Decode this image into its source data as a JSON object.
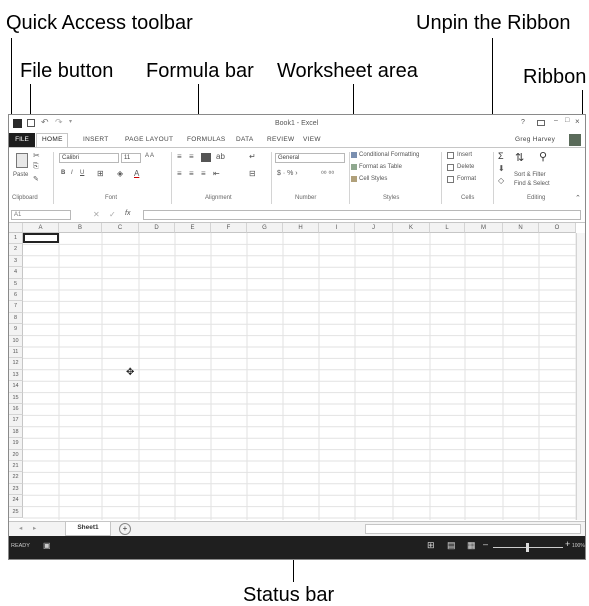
{
  "callouts": {
    "quick_access": "Quick Access toolbar",
    "file_button": "File button",
    "formula_bar": "Formula bar",
    "worksheet_area": "Worksheet area",
    "unpin_ribbon": "Unpin the Ribbon",
    "ribbon": "Ribbon",
    "status_bar": "Status bar"
  },
  "window": {
    "title": "Book1 - Excel",
    "help": "?",
    "user": "Greg Harvey",
    "controls": [
      "?",
      "—",
      "□",
      "×"
    ]
  },
  "tabs": [
    "FILE",
    "HOME",
    "INSERT",
    "PAGE LAYOUT",
    "FORMULAS",
    "DATA",
    "REVIEW",
    "VIEW"
  ],
  "ribbon": {
    "clipboard": {
      "paste": "Paste",
      "label": "Clipboard"
    },
    "font": {
      "name": "Calibri",
      "size": "11",
      "label": "Font"
    },
    "alignment": {
      "label": "Alignment"
    },
    "number": {
      "format": "General",
      "label": "Number"
    },
    "styles": {
      "items": [
        "Conditional Formatting",
        "Format as Table",
        "Cell Styles"
      ],
      "label": "Styles"
    },
    "cells": {
      "items": [
        "Insert",
        "Delete",
        "Format"
      ],
      "label": "Cells"
    },
    "editing": {
      "items": [
        "Sort & Filter",
        "Find & Select"
      ],
      "label": "Editing"
    }
  },
  "formula_bar": {
    "name_box": "A1",
    "fx": "fx",
    "value": ""
  },
  "columns": [
    "A",
    "B",
    "C",
    "D",
    "E",
    "F",
    "G",
    "H",
    "I",
    "J",
    "K",
    "L",
    "M",
    "N",
    "O"
  ],
  "rows": [
    "1",
    "2",
    "3",
    "4",
    "5",
    "6",
    "7",
    "8",
    "9",
    "10",
    "11",
    "12",
    "13",
    "14",
    "15",
    "16",
    "17",
    "18",
    "19",
    "20",
    "21",
    "22",
    "23",
    "24",
    "25"
  ],
  "sheet_tabs": {
    "active": "Sheet1",
    "add": "+"
  },
  "status": {
    "ready": "READY",
    "zoom": "100%"
  }
}
